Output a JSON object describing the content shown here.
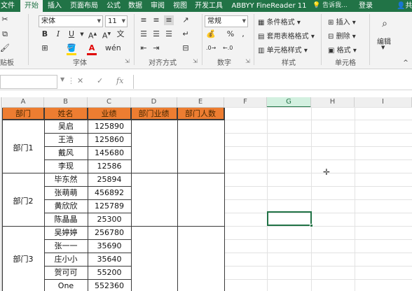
{
  "tabs": {
    "file": "文件",
    "home": "开始",
    "insert": "插入",
    "page_layout": "页面布局",
    "formulas": "公式",
    "data": "数据",
    "review": "审阅",
    "view": "视图",
    "developer": "开发工具",
    "abbyy": "ABBYY FineReader 11",
    "tell_me": "告诉我...",
    "login": "登录",
    "share": "共享"
  },
  "ribbon": {
    "paste_tail": "贴板",
    "font_name": "宋体",
    "font_size": "11",
    "font_group": "字体",
    "align_group": "对齐方式",
    "number_format": "常规",
    "number_group": "数字",
    "cond_format": "条件格式",
    "table_format": "套用表格格式",
    "cell_styles": "单元格样式",
    "styles_group": "样式",
    "insert": "插入",
    "delete": "删除",
    "format": "格式",
    "cells_group": "单元格",
    "edit": "编辑",
    "bold": "B",
    "italic": "I",
    "underline": "U"
  },
  "formula_bar": {
    "fx": "fx",
    "name_box": "",
    "content": ""
  },
  "columns": [
    "A",
    "B",
    "C",
    "D",
    "E",
    "F",
    "G",
    "H",
    "I"
  ],
  "headers": [
    "部门",
    "姓名",
    "业绩",
    "部门业绩",
    "部门人数"
  ],
  "depts": [
    "部门1",
    "部门2",
    "部门3"
  ],
  "rows": [
    {
      "name": "吴启",
      "value": "125890"
    },
    {
      "name": "王浩",
      "value": "125860"
    },
    {
      "name": "戴风",
      "value": "145680"
    },
    {
      "name": "李现",
      "value": "12586"
    },
    {
      "name": "毕东然",
      "value": "25894"
    },
    {
      "name": "张萌萌",
      "value": "456892"
    },
    {
      "name": "黄欣欣",
      "value": "125789"
    },
    {
      "name": "陈晶晶",
      "value": "25300"
    },
    {
      "name": "吴婷婷",
      "value": "256780"
    },
    {
      "name": "张一一",
      "value": "35690"
    },
    {
      "name": "庄小小",
      "value": "35640"
    },
    {
      "name": "贺可可",
      "value": "55200"
    },
    {
      "name": "One",
      "value": "552360"
    }
  ],
  "colors": {
    "excel_green": "#217346",
    "header_orange": "#ed7d31",
    "font_color_red": "#e00000",
    "fill_yellow": "#ffd700"
  }
}
